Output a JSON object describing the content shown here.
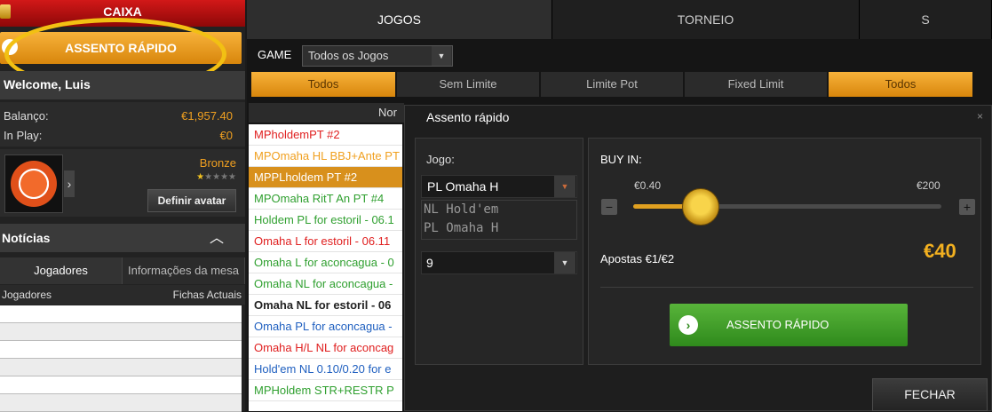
{
  "left": {
    "caixa": "CAIXA",
    "quick_seat": "ASSENTO RÁPIDO",
    "welcome": "Welcome, Luis",
    "balance_label": "Balanço:",
    "balance_value": "€1,957.40",
    "inplay_label": "In Play:",
    "inplay_value": "€0",
    "rank": "Bronze",
    "stars_filled": 1,
    "stars_total": 5,
    "define_avatar": "Definir avatar",
    "news": "Notícias",
    "tab_players": "Jogadores",
    "tab_table_info": "Informações da mesa",
    "col_players": "Jogadores",
    "col_chips": "Fichas Actuais"
  },
  "top_tabs": {
    "jogos": "JOGOS",
    "torneio": "TORNEIO",
    "third": "S"
  },
  "game_filter": {
    "label": "GAME",
    "selected": "Todos os Jogos"
  },
  "filters": [
    {
      "label": "Todos",
      "active": true,
      "w": 162
    },
    {
      "label": "Sem Limite",
      "active": false,
      "w": 160
    },
    {
      "label": "Limite Pot",
      "active": false,
      "w": 160
    },
    {
      "label": "Fixed Limit",
      "active": false,
      "w": 160
    },
    {
      "label": "Todos",
      "active": true,
      "w": 162
    }
  ],
  "list_header": "Nor",
  "games": [
    {
      "name": "MPholdemPT #2",
      "color": "#e02020",
      "bg": "#ffffff"
    },
    {
      "name": "MPOmaha HL BBJ+Ante PT",
      "color": "#f0a020",
      "bg": "#ffffff"
    },
    {
      "name": "MPPLholdem PT #2",
      "color": "#ffffff",
      "bg": "#d8901c"
    },
    {
      "name": "MPOmaha RitT An PT #4",
      "color": "#30a030",
      "bg": "#ffffff"
    },
    {
      "name": "Holdem PL for estoril - 06.1",
      "color": "#30a030",
      "bg": "#ffffff"
    },
    {
      "name": "Omaha L for estoril - 06.11",
      "color": "#e02020",
      "bg": "#ffffff"
    },
    {
      "name": "Omaha L for aconcagua - 0",
      "color": "#30a030",
      "bg": "#ffffff"
    },
    {
      "name": "Omaha NL for aconcagua -",
      "color": "#30a030",
      "bg": "#ffffff"
    },
    {
      "name": "Omaha NL for estoril - 06",
      "color": "#222222",
      "bg": "#ffffff",
      "bold": true
    },
    {
      "name": "Omaha PL for aconcagua -",
      "color": "#2060c0",
      "bg": "#ffffff"
    },
    {
      "name": "Omaha H/L NL for aconcag",
      "color": "#e02020",
      "bg": "#ffffff"
    },
    {
      "name": "Hold'em NL 0.10/0.20 for e",
      "color": "#2060c0",
      "bg": "#ffffff"
    },
    {
      "name": "MPHoldem STR+RESTR P",
      "color": "#30a030",
      "bg": "#ffffff"
    }
  ],
  "dialog": {
    "title": "Assento rápido",
    "close": "×",
    "jogo_label": "Jogo:",
    "jogo_selected": "PL Omaha H",
    "jogo_options": [
      "NL Hold'em",
      "PL Omaha H"
    ],
    "seats_selected": "9",
    "buyin_label": "BUY IN:",
    "min": "€0.40",
    "max": "€200",
    "slider_fraction": 0.22,
    "bets": "Apostas €1/€2",
    "amount": "€40",
    "seat_button": "ASSENTO RÁPIDO",
    "close_button": "FECHAR"
  },
  "colors": {
    "accent": "#f2c013",
    "orange": "#d8860c",
    "green": "#2f8a1c",
    "red": "#c81010"
  }
}
